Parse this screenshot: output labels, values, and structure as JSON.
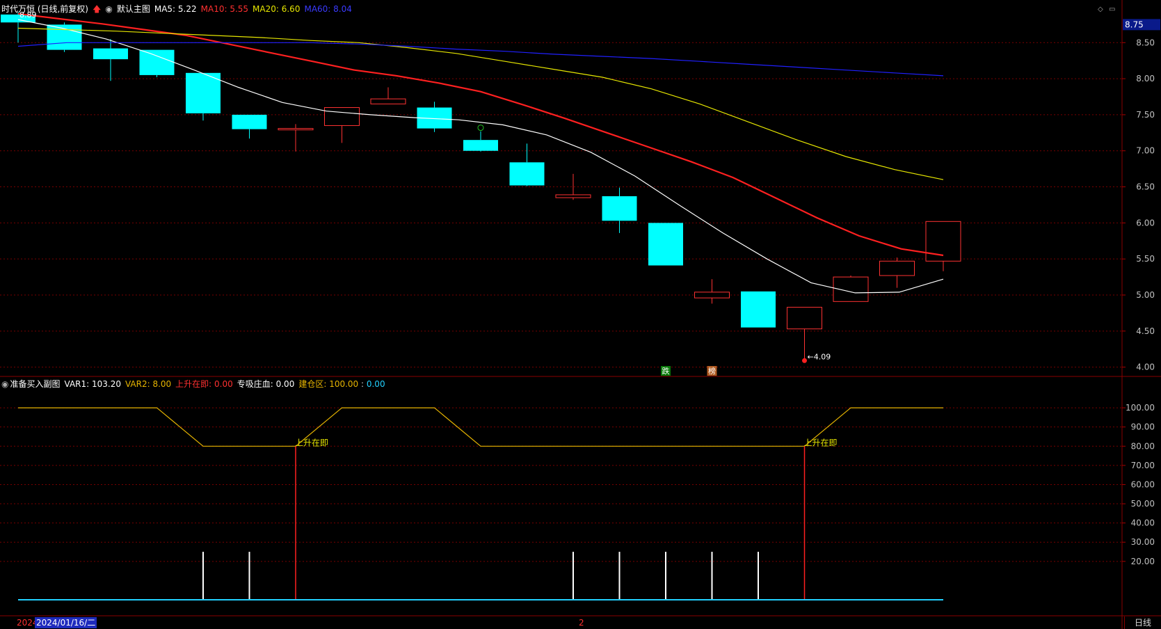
{
  "main_header": {
    "stock_label": "时代万恒 (日线,前复权)",
    "chart_mode": "默认主图",
    "ma5": "MA5: 5.22",
    "ma10": "MA10: 5.55",
    "ma20": "MA20: 6.60",
    "ma60": "MA60: 8.04"
  },
  "sub_header": {
    "title": "准备买入副图",
    "var1": "VAR1: 103.20",
    "var2": "VAR2: 8.00",
    "rise": "上升在即: 0.00",
    "suck": "专吸庄血: 0.00",
    "build_label": "建仓区: ",
    "build_a": "100.00",
    "build_sep": " : ",
    "build_b": "0.00"
  },
  "footer": {
    "year_partial": "2024",
    "date": "2024/01/16/二",
    "mid_marker": "2",
    "period_tab": "日线"
  },
  "colors": {
    "up": "#ff3232",
    "down": "#00ffff",
    "ma5": "#ffffff",
    "ma10": "#ff2020",
    "ma20": "#e6e600",
    "ma60": "#2020ff",
    "grid": "#7a0000",
    "axis_text": "#c0c0c0",
    "var_line": "#e6b400"
  },
  "chart_data": [
    {
      "type": "candlestick",
      "name": "main",
      "ylim": [
        3.9,
        8.85
      ],
      "y_ticks": [
        "8.50",
        "8.00",
        "7.50",
        "7.00",
        "6.50",
        "6.00",
        "5.50",
        "5.00",
        "4.50",
        "4.00"
      ],
      "y_tick_values": [
        8.5,
        8.0,
        7.5,
        7.0,
        6.5,
        6.0,
        5.5,
        5.0,
        4.5,
        4.0
      ],
      "current_price_label": "8.75",
      "current_price": 8.75,
      "annotations": [
        {
          "text": "8.89",
          "x_index": 0,
          "y": 8.89
        },
        {
          "text": "←4.09",
          "x_index": 17,
          "y": 4.09
        }
      ],
      "markers": [
        {
          "text": "跌",
          "x_index": 14
        },
        {
          "text": "榜",
          "x_index": 15
        }
      ],
      "candles": [
        {
          "o": 8.89,
          "h": 8.92,
          "l": 8.5,
          "c": 8.78
        },
        {
          "o": 8.75,
          "h": 8.78,
          "l": 8.37,
          "c": 8.4
        },
        {
          "o": 8.42,
          "h": 8.55,
          "l": 7.97,
          "c": 8.27
        },
        {
          "o": 8.4,
          "h": 8.4,
          "l": 8.02,
          "c": 8.05
        },
        {
          "o": 8.08,
          "h": 8.08,
          "l": 7.42,
          "c": 7.52
        },
        {
          "o": 7.5,
          "h": 7.5,
          "l": 7.17,
          "c": 7.3
        },
        {
          "o": 7.29,
          "h": 7.37,
          "l": 6.99,
          "c": 7.31
        },
        {
          "o": 7.35,
          "h": 7.6,
          "l": 7.11,
          "c": 7.6
        },
        {
          "o": 7.65,
          "h": 7.88,
          "l": 7.65,
          "c": 7.72
        },
        {
          "o": 7.6,
          "h": 7.68,
          "l": 7.26,
          "c": 7.31
        },
        {
          "o": 7.15,
          "h": 7.27,
          "l": 6.99,
          "c": 7.0
        },
        {
          "o": 6.84,
          "h": 7.1,
          "l": 6.51,
          "c": 6.52
        },
        {
          "o": 6.35,
          "h": 6.68,
          "l": 6.32,
          "c": 6.39
        },
        {
          "o": 6.37,
          "h": 6.49,
          "l": 5.86,
          "c": 6.03
        },
        {
          "o": 6.0,
          "h": 6.0,
          "l": 5.41,
          "c": 5.41
        },
        {
          "o": 4.96,
          "h": 5.22,
          "l": 4.88,
          "c": 5.04
        },
        {
          "o": 5.05,
          "h": 5.05,
          "l": 4.55,
          "c": 4.55
        },
        {
          "o": 4.53,
          "h": 4.83,
          "l": 4.09,
          "c": 4.83
        },
        {
          "o": 4.91,
          "h": 5.27,
          "l": 4.91,
          "c": 5.25
        },
        {
          "o": 5.27,
          "h": 5.52,
          "l": 5.1,
          "c": 5.47
        },
        {
          "o": 5.47,
          "h": 6.02,
          "l": 5.33,
          "c": 6.02
        }
      ],
      "series": [
        {
          "name": "MA5",
          "values": [
            8.82,
            8.7,
            8.55,
            8.35,
            8.12,
            7.88,
            7.67,
            7.55,
            7.5,
            7.46,
            7.43,
            7.36,
            7.22,
            6.98,
            6.65,
            6.25,
            5.86,
            5.5,
            5.17,
            5.03,
            5.04,
            5.22
          ]
        },
        {
          "name": "MA10",
          "values": [
            8.9,
            8.83,
            8.76,
            8.68,
            8.6,
            8.48,
            8.36,
            8.24,
            8.12,
            8.04,
            7.94,
            7.82,
            7.64,
            7.45,
            7.25,
            7.05,
            6.85,
            6.63,
            6.35,
            6.07,
            5.82,
            5.64,
            5.55
          ]
        },
        {
          "name": "MA20",
          "values": [
            8.7,
            8.68,
            8.66,
            8.63,
            8.6,
            8.57,
            8.53,
            8.5,
            8.43,
            8.35,
            8.24,
            8.13,
            8.02,
            7.86,
            7.65,
            7.4,
            7.15,
            6.92,
            6.74,
            6.6
          ]
        },
        {
          "name": "MA60",
          "values": [
            8.45,
            8.5,
            8.5,
            8.5,
            8.5,
            8.5,
            8.5,
            8.48,
            8.45,
            8.41,
            8.38,
            8.34,
            8.31,
            8.28,
            8.24,
            8.2,
            8.16,
            8.12,
            8.08,
            8.04
          ]
        }
      ]
    },
    {
      "type": "line",
      "name": "sub",
      "ylim": [
        0,
        108
      ],
      "y_ticks": [
        "100.00",
        "90.00",
        "80.00",
        "70.00",
        "60.00",
        "50.00",
        "40.00",
        "30.00",
        "20.00"
      ],
      "y_tick_values": [
        100,
        90,
        80,
        70,
        60,
        50,
        40,
        30,
        20
      ],
      "var1_line": [
        100,
        100,
        100,
        100,
        80,
        80,
        80,
        100,
        100,
        100,
        80,
        80,
        80,
        80,
        80,
        80,
        80,
        80,
        100,
        100,
        100
      ],
      "rise_signals": [
        6,
        17
      ],
      "rise_label": "上升在即",
      "white_bars": [
        4,
        5,
        12,
        13,
        14,
        15,
        16
      ],
      "white_bar_value": 25,
      "baseline_value": 0
    }
  ]
}
